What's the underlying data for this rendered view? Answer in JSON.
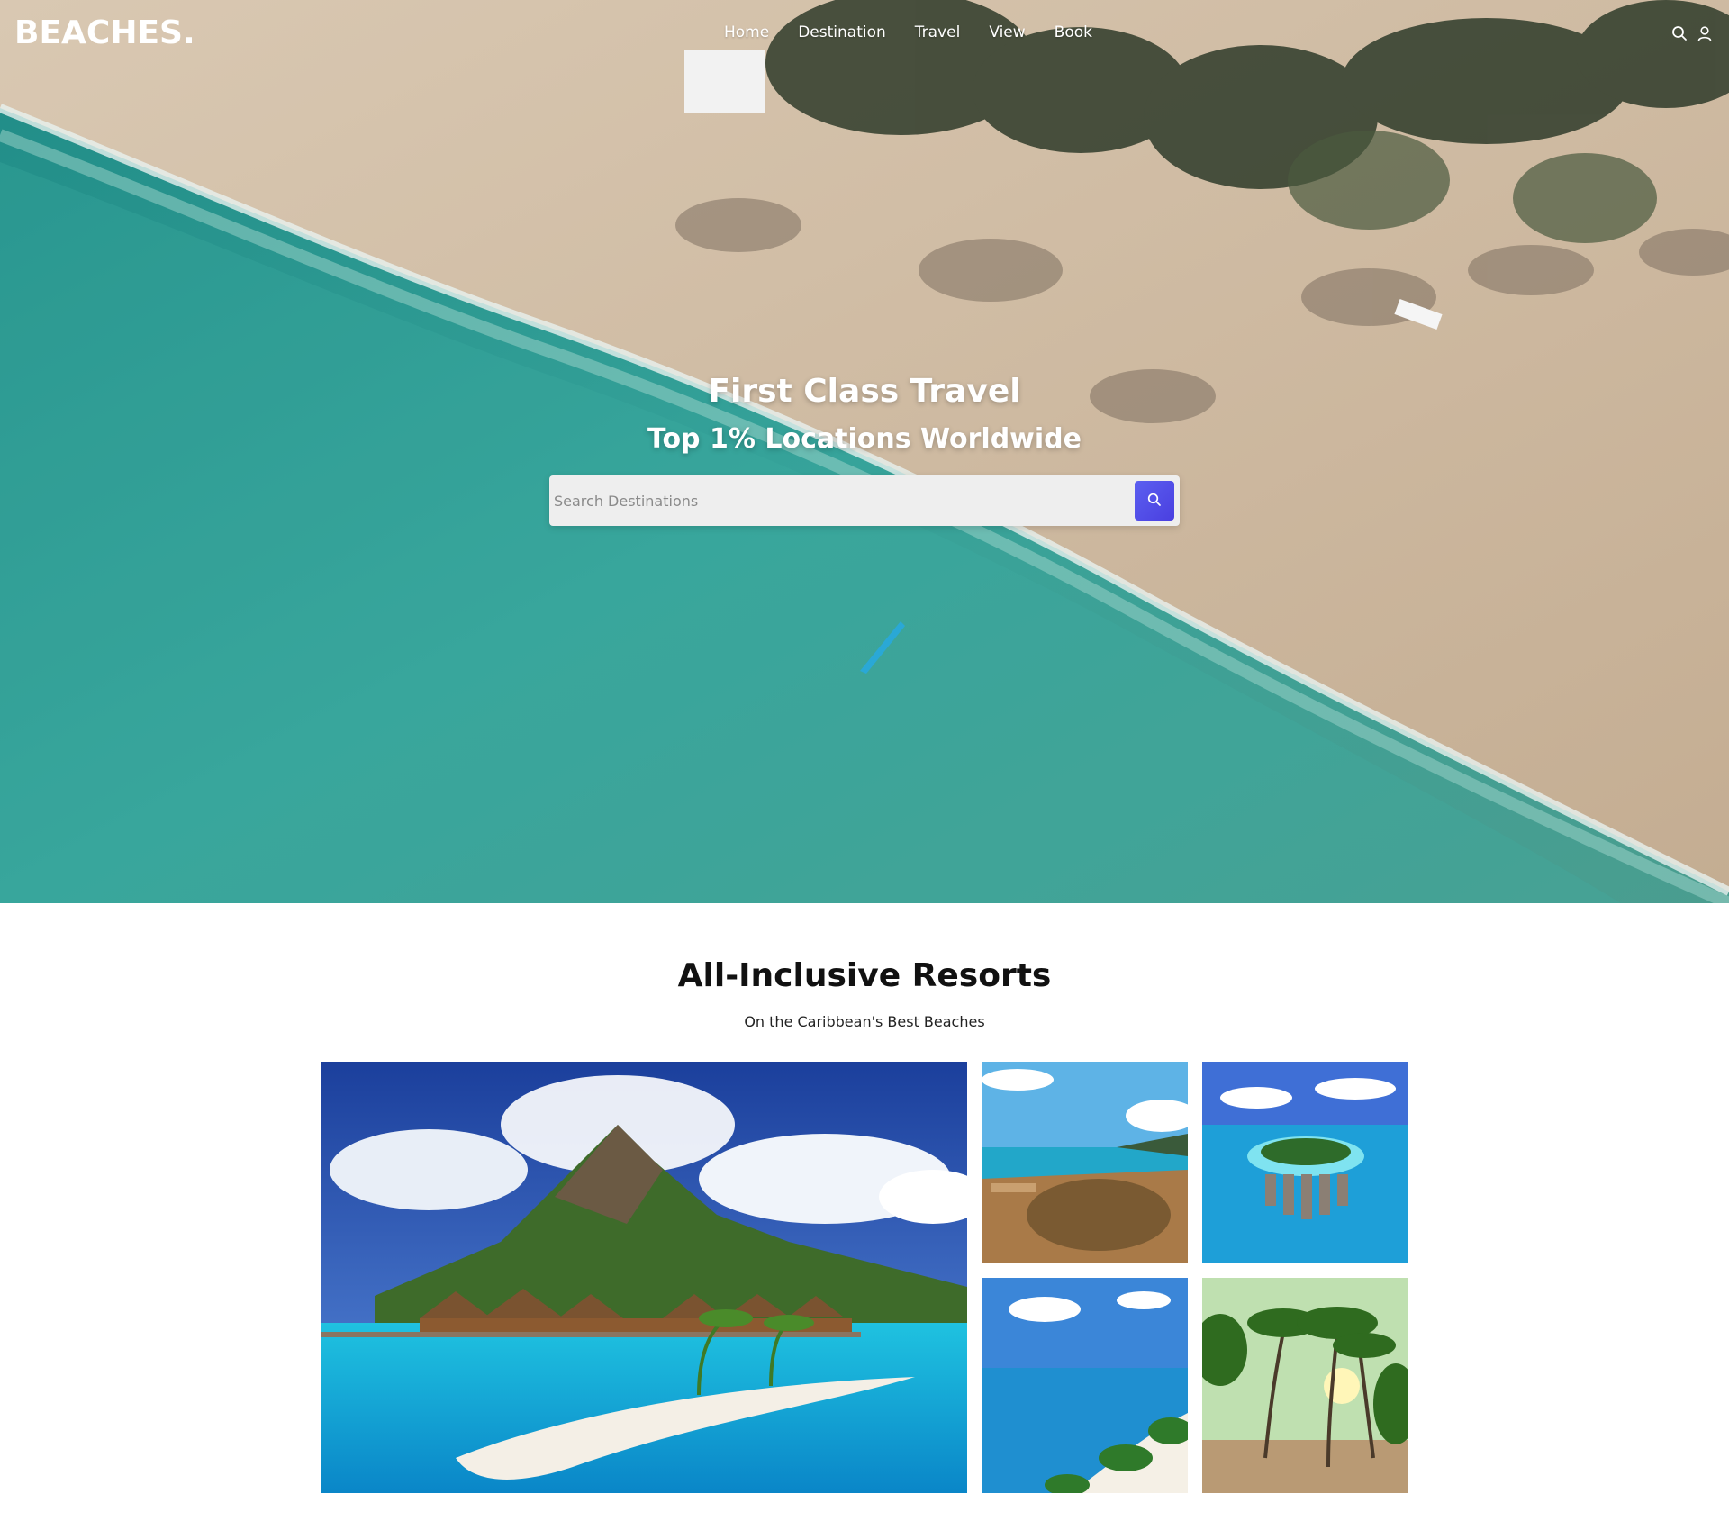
{
  "header": {
    "logo": "BEACHES.",
    "nav": [
      "Home",
      "Destination",
      "Travel",
      "View",
      "Book"
    ],
    "icons": [
      "search-icon",
      "user-icon"
    ]
  },
  "hero": {
    "title": "First Class Travel",
    "subtitle": "Top 1% Locations Worldwide",
    "search": {
      "placeholder": "Search Destinations",
      "value": "",
      "button_icon": "search-icon"
    }
  },
  "resorts": {
    "title": "All-Inclusive Resorts",
    "subtitle": "On the Caribbean's Best Beaches",
    "images": [
      "overwater-bungalows-mountain-photo",
      "coastline-aerial-photo",
      "island-resort-aerial-photo",
      "beach-coast-aerial-photo",
      "palm-trees-beach-photo"
    ]
  },
  "colors": {
    "accent": "#4f46e5",
    "sea": "#3aa49a",
    "sand": "#cbb9a2",
    "text_dark": "#111111"
  }
}
